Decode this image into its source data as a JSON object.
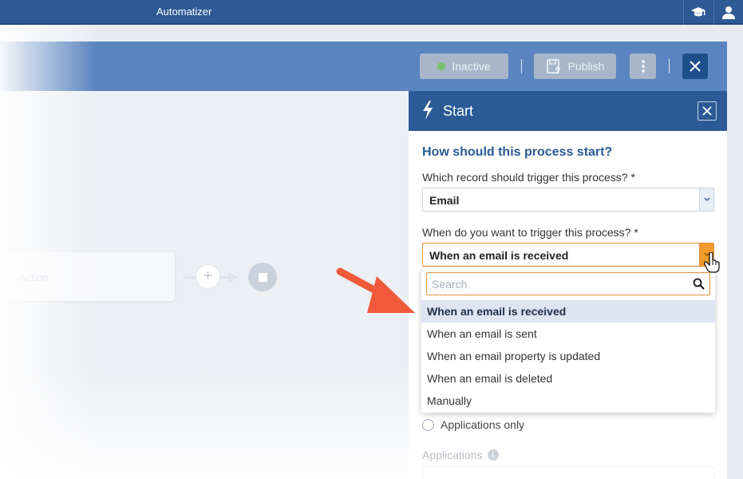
{
  "app": {
    "title": "Automatizer"
  },
  "appbar": {
    "icons": [
      "graduation-cap-icon",
      "user-icon"
    ]
  },
  "toolbar": {
    "inactive_label": "Inactive",
    "publish_label": "Publish",
    "status_color": "#7bc36a"
  },
  "canvas": {
    "action_label": "Action",
    "add_symbol": "+"
  },
  "panel": {
    "title": "Start",
    "section_title": "How should this process start?",
    "record_label": "Which record should trigger this process? *",
    "record_value": "Email",
    "trigger_label": "When do you want to trigger this process? *",
    "trigger_value": "When an email is received",
    "radio_label": "Applications only",
    "applications_label": "Applications",
    "info_symbol": "i"
  },
  "dropdown": {
    "search_placeholder": "Search",
    "options": [
      "When an email is received",
      "When an email is sent",
      "When an email property is updated",
      "When an email is deleted",
      "Manually"
    ],
    "selected_index": 0
  },
  "colors": {
    "brand": "#2b5a95",
    "accent": "#f39a2c",
    "annotation_arrow": "#f05a3a"
  }
}
